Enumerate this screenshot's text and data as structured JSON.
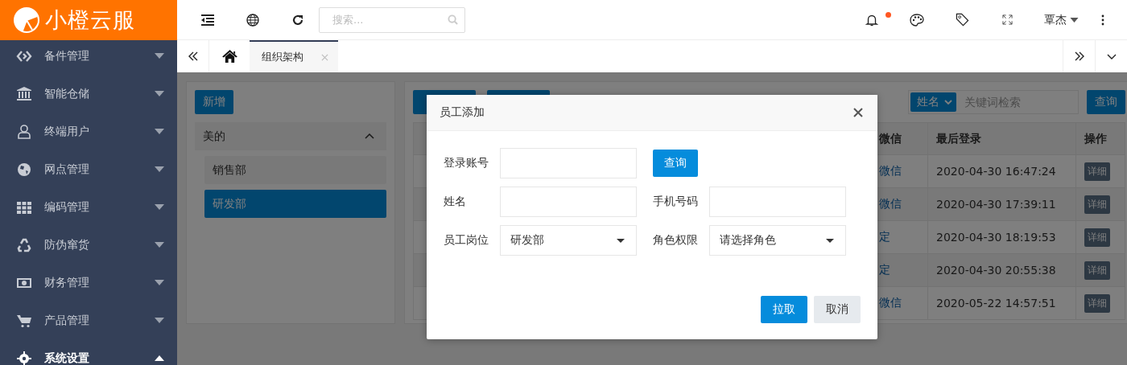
{
  "logo": {
    "text": "小橙云服"
  },
  "sidebar": {
    "items": [
      {
        "label": "备件管理",
        "expanded": false
      },
      {
        "label": "智能仓储",
        "expanded": false
      },
      {
        "label": "终端用户",
        "expanded": false
      },
      {
        "label": "网点管理",
        "expanded": false
      },
      {
        "label": "编码管理",
        "expanded": false
      },
      {
        "label": "防伪窜货",
        "expanded": false
      },
      {
        "label": "财务管理",
        "expanded": false
      },
      {
        "label": "产品管理",
        "expanded": false
      },
      {
        "label": "系统设置",
        "expanded": true
      }
    ]
  },
  "topbar": {
    "search": {
      "placeholder": "搜索..."
    },
    "unread_notifications": true,
    "user": "覃杰"
  },
  "tabs": [
    {
      "label": "组织架构",
      "selected": true
    }
  ],
  "org_tree": {
    "add_button": "新增",
    "root": {
      "label": "美的",
      "expanded": true,
      "children": [
        {
          "label": "销售部",
          "selected": false
        },
        {
          "label": "研发部",
          "selected": true
        }
      ]
    }
  },
  "employee_table": {
    "search": {
      "field": "姓名",
      "placeholder": "关键词检索",
      "button": "查询"
    },
    "columns": [
      "微信",
      "最后登录",
      "操作"
    ],
    "rows": [
      {
        "wechat": "微信",
        "last_login": "2020-04-30 16:47:24",
        "action": "详细"
      },
      {
        "wechat": "微信",
        "last_login": "2020-04-30 17:39:11",
        "action": "详细"
      },
      {
        "wechat": "定",
        "last_login": "2020-04-30 18:19:53",
        "action": "详细"
      },
      {
        "wechat": "定",
        "last_login": "2020-04-30 20:55:38",
        "action": "详细"
      },
      {
        "wechat": "微信",
        "last_login": "2020-05-22 14:57:51",
        "action": "详细"
      }
    ]
  },
  "dialog": {
    "title": "员工添加",
    "cells": [
      {
        "kind": "input",
        "label": "登录账号"
      },
      {
        "kind": "button",
        "label": "查询"
      },
      {
        "kind": "input",
        "label": "姓名"
      },
      {
        "kind": "input",
        "label": "手机号码"
      },
      {
        "kind": "select",
        "label": "员工岗位",
        "value": "研发部"
      },
      {
        "kind": "select",
        "label": "角色权限",
        "placeholder": "请选择角色"
      }
    ],
    "buttons": [
      {
        "label": "拉取",
        "kind": "primary"
      },
      {
        "label": "取消",
        "kind": "default"
      }
    ]
  }
}
